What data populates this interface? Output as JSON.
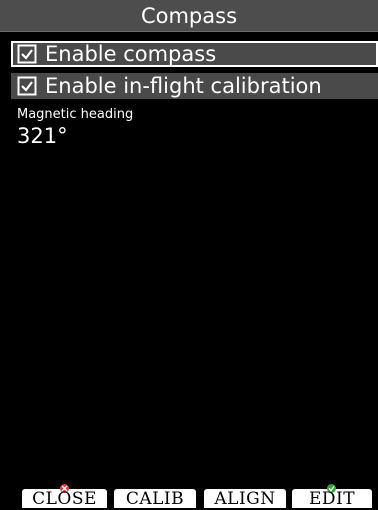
{
  "window": {
    "title": "Compass"
  },
  "options": [
    {
      "label": "Enable compass",
      "checked": true,
      "selected": true
    },
    {
      "label": "Enable in-flight calibration",
      "checked": true,
      "selected": false
    }
  ],
  "heading": {
    "label": "Magnetic heading",
    "value": "321°"
  },
  "softkeys": {
    "close": "CLOSE",
    "calib": "CALIB",
    "align": "ALIGN",
    "edit": "EDIT"
  },
  "icons": {
    "checkbox": "checked-box-icon",
    "close_indicator": "red-x-icon",
    "edit_indicator": "green-check-icon"
  },
  "colors": {
    "background": "#000000",
    "title_bar": "#4d4d4d",
    "row_background": "#4a4a4a",
    "selection_border": "#ffffff",
    "softkey_background": "#ffffff",
    "close_indicator": "#e23a3a",
    "edit_indicator": "#2fa83a"
  }
}
